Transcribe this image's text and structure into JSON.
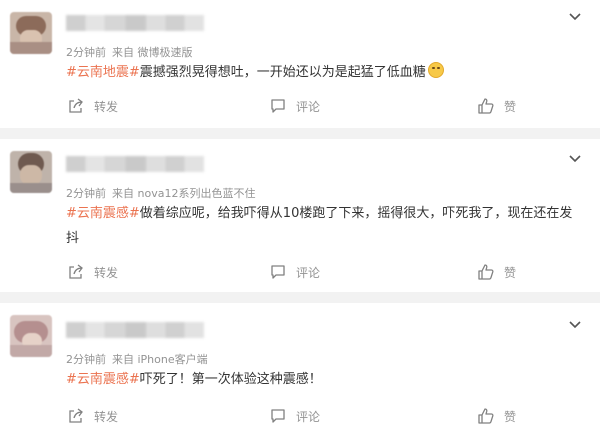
{
  "posts": [
    {
      "time": "2分钟前",
      "source": "来自 微博极速版",
      "topic": "#云南地震#",
      "text": "震撼强烈晃得想吐，一开始还以为是起猛了低血糖",
      "has_emoji": true,
      "emoji_icon": "smiling-face-icon",
      "actions": {
        "share": "转发",
        "comment": "评论",
        "like": "赞"
      }
    },
    {
      "time": "2分钟前",
      "source": "来自 nova12系列出色蓝不住",
      "topic": "#云南震感#",
      "text_line1": "做着综应呢，给我吓得从10楼跑了下来，摇得很大，吓死我了，现在还在发",
      "text_line2": "抖",
      "actions": {
        "share": "转发",
        "comment": "评论",
        "like": "赞"
      }
    },
    {
      "time": "2分钟前",
      "source": "来自 iPhone客户端",
      "topic": "#云南震感#",
      "text": "吓死了！第一次体验这种震感！",
      "actions": {
        "share": "转发",
        "comment": "评论",
        "like": "赞"
      }
    }
  ],
  "colors": {
    "topic": "#eb7350",
    "meta": "#939393",
    "divider": "#f2f2f2",
    "text": "#333333"
  }
}
